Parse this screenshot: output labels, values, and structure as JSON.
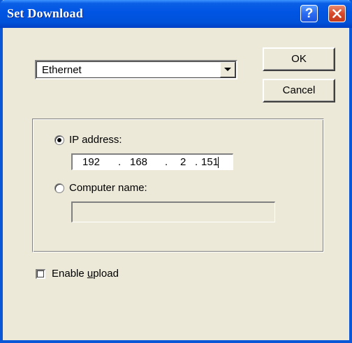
{
  "window": {
    "title": "Set Download",
    "help_glyph": "?",
    "close_icon": "close-icon",
    "titlebar_color": "#0054e3",
    "face_color": "#ece9d8"
  },
  "connection": {
    "selected": "Ethernet",
    "arrow_icon": "chevron-down-icon"
  },
  "buttons": {
    "ok_label": "OK",
    "cancel_label": "Cancel"
  },
  "address_group": {
    "ip_option_label": "IP address:",
    "ip_selected": true,
    "ip_octets": [
      "192",
      "168",
      "2",
      "151"
    ],
    "ip_separator": ".",
    "computer_option_label": "Computer name:",
    "computer_name_value": ""
  },
  "upload": {
    "label_prefix": "Enable ",
    "label_accel": "u",
    "label_rest": "pload",
    "checked": false
  }
}
